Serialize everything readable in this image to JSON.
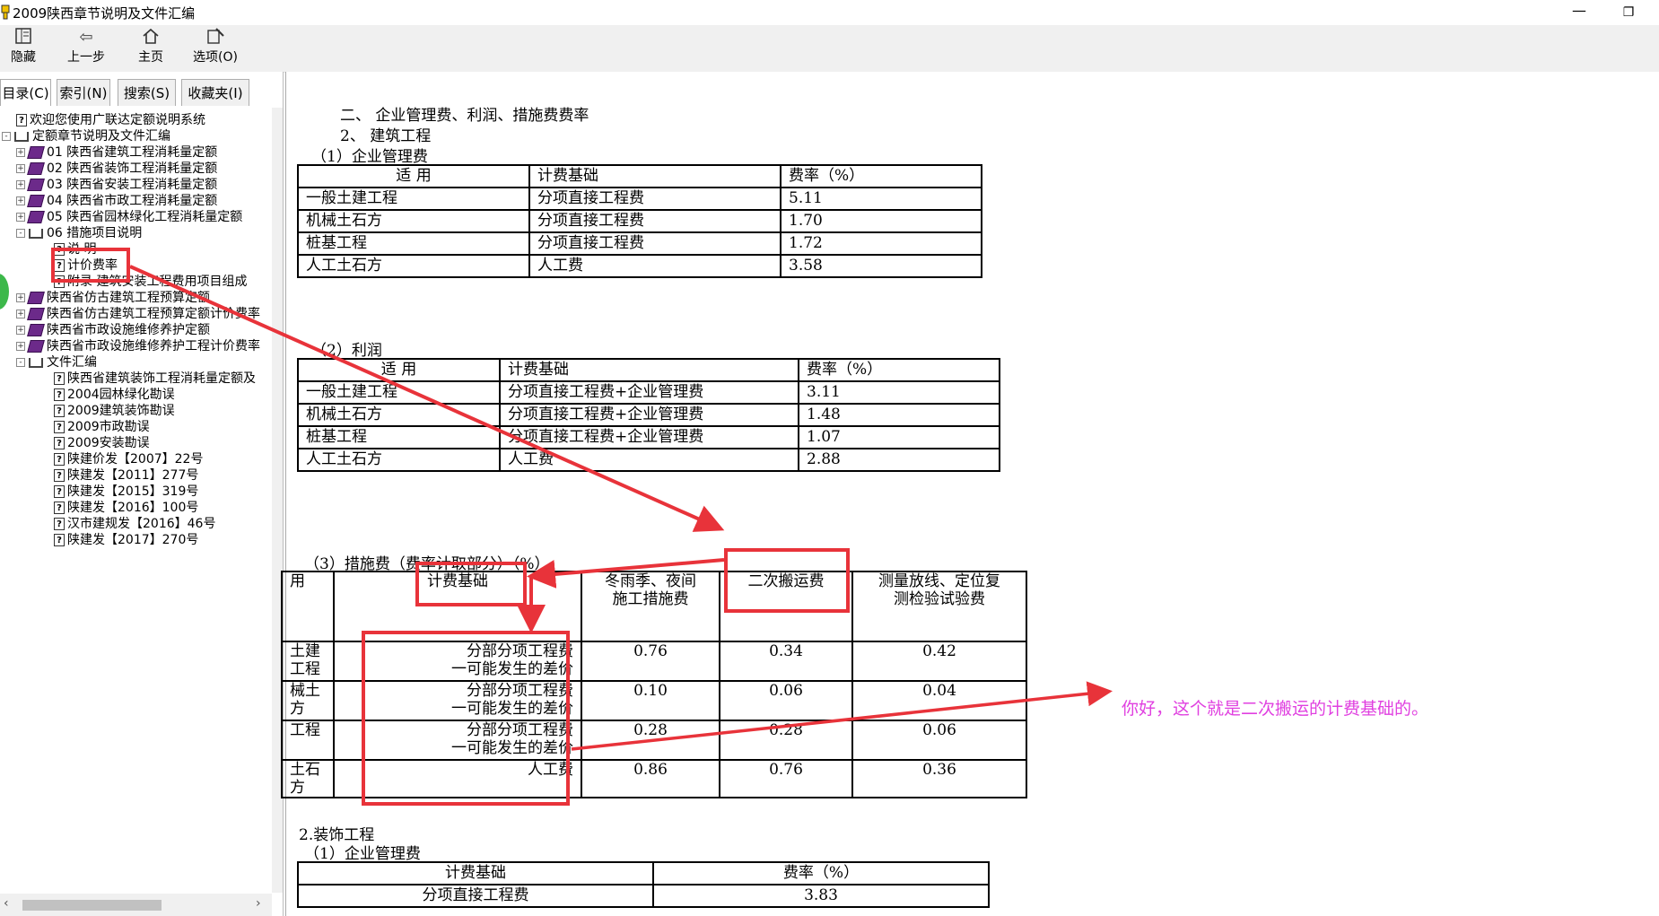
{
  "window": {
    "title": "2009陕西章节说明及文件汇编",
    "minimize": "—",
    "maximize": "❐"
  },
  "toolbar": {
    "hide": "隐藏",
    "back": "上一步",
    "home": "主页",
    "options": "选项(O)"
  },
  "tabs": [
    "目录(C)",
    "索引(N)",
    "搜索(S)",
    "收藏夹(I)"
  ],
  "tree": [
    {
      "label": "欢迎您使用广联达定额说明系统",
      "icon": "help-doc",
      "indent": 1
    },
    {
      "label": "定额章节说明及文件汇编",
      "icon": "book-open",
      "indent": 0,
      "exp": "-"
    },
    {
      "label": "01 陕西省建筑工程消耗量定额",
      "icon": "book-closed",
      "indent": 1,
      "exp": "+"
    },
    {
      "label": "02 陕西省装饰工程消耗量定额",
      "icon": "book-closed",
      "indent": 1,
      "exp": "+"
    },
    {
      "label": "03 陕西省安装工程消耗量定额",
      "icon": "book-closed",
      "indent": 1,
      "exp": "+"
    },
    {
      "label": "04 陕西省市政工程消耗量定额",
      "icon": "book-closed",
      "indent": 1,
      "exp": "+"
    },
    {
      "label": "05 陕西省园林绿化工程消耗量定额",
      "icon": "book-closed",
      "indent": 1,
      "exp": "+"
    },
    {
      "label": "06 措施项目说明",
      "icon": "book-open",
      "indent": 1,
      "exp": "-"
    },
    {
      "label": "说 明",
      "icon": "help-doc",
      "indent": 2
    },
    {
      "label": "计价费率",
      "icon": "help-doc",
      "indent": 2
    },
    {
      "label": "附录 建筑安装工程费用项目组成",
      "icon": "help-doc",
      "indent": 2
    },
    {
      "label": "陕西省仿古建筑工程预算定额",
      "icon": "book-closed",
      "indent": 1,
      "exp": "+"
    },
    {
      "label": "陕西省仿古建筑工程预算定额计价费率",
      "icon": "book-closed",
      "indent": 1,
      "exp": "+"
    },
    {
      "label": "陕西省市政设施维修养护定额",
      "icon": "book-closed",
      "indent": 1,
      "exp": "+"
    },
    {
      "label": "陕西省市政设施维修养护工程计价费率",
      "icon": "book-closed",
      "indent": 1,
      "exp": "+"
    },
    {
      "label": "文件汇编",
      "icon": "book-open",
      "indent": 1,
      "exp": "-"
    },
    {
      "label": "陕西省建筑装饰工程消耗量定额及",
      "icon": "help-doc",
      "indent": 2
    },
    {
      "label": "2004园林绿化勘误",
      "icon": "help-doc",
      "indent": 2
    },
    {
      "label": "2009建筑装饰勘误",
      "icon": "help-doc",
      "indent": 2
    },
    {
      "label": "2009市政勘误",
      "icon": "help-doc",
      "indent": 2
    },
    {
      "label": "2009安装勘误",
      "icon": "help-doc",
      "indent": 2
    },
    {
      "label": "陕建价发【2007】22号",
      "icon": "help-doc",
      "indent": 2
    },
    {
      "label": "陕建发【2011】277号",
      "icon": "help-doc",
      "indent": 2
    },
    {
      "label": "陕建发【2015】319号",
      "icon": "help-doc",
      "indent": 2
    },
    {
      "label": "陕建发【2016】100号",
      "icon": "help-doc",
      "indent": 2
    },
    {
      "label": "汉市建规发【2016】46号",
      "icon": "help-doc",
      "indent": 2
    },
    {
      "label": "陕建发【2017】270号",
      "icon": "help-doc",
      "indent": 2
    }
  ],
  "doc": {
    "heading1": "二、   企业管理费、利润、措施费费率",
    "heading2": "2、      建筑工程",
    "sec1_title": "（1）企业管理费",
    "table1": {
      "headers": [
        "适  用",
        "计费基础",
        "费率（%）"
      ],
      "rows": [
        [
          "一般土建工程",
          "分项直接工程费",
          "5.11"
        ],
        [
          "机械土石方",
          "分项直接工程费",
          "1.70"
        ],
        [
          "桩基工程",
          "分项直接工程费",
          "1.72"
        ],
        [
          "人工土石方",
          "人工费",
          "3.58"
        ]
      ]
    },
    "sec2_title": "（2）利润",
    "table2": {
      "headers": [
        "适  用",
        "计费基础",
        "费率（%）"
      ],
      "rows": [
        [
          "一般土建工程",
          "分项直接工程费+企业管理费",
          "3.11"
        ],
        [
          "机械土石方",
          "分项直接工程费+企业管理费",
          "1.48"
        ],
        [
          "桩基工程",
          "分项直接工程费+企业管理费",
          "1.07"
        ],
        [
          "人工土石方",
          "人工费",
          "2.88"
        ]
      ]
    },
    "sec3_title": "（3）措施费（费率计取部分）（%）",
    "table3": {
      "headers": [
        "用",
        "计费基础",
        "冬雨季、夜间\n施工措施费",
        "二次搬运费",
        "测量放线、定位复\n测检验试验费"
      ],
      "rows": [
        [
          "土建\n工程",
          "分部分项工程费\n一可能发生的差价",
          "0.76",
          "0.34",
          "0.42"
        ],
        [
          "械土\n方",
          "分部分项工程费\n一可能发生的差价",
          "0.10",
          "0.06",
          "0.04"
        ],
        [
          "工程",
          "分部分项工程费\n一可能发生的差价",
          "0.28",
          "0.28",
          "0.06"
        ],
        [
          "土石方",
          "人工费",
          "0.86",
          "0.76",
          "0.36"
        ]
      ]
    },
    "sec4_title": "2.装饰工程",
    "sec4_sub": "（1）企业管理费",
    "table4": {
      "headers": [
        "计费基础",
        "费率（%）"
      ],
      "rows": [
        [
          "分项直接工程费",
          "3.83"
        ]
      ]
    }
  },
  "annotation": {
    "note": "你好，这个就是二次搬运的计费基础的。",
    "color": "#e8333a",
    "note_color": "#e040e0"
  }
}
